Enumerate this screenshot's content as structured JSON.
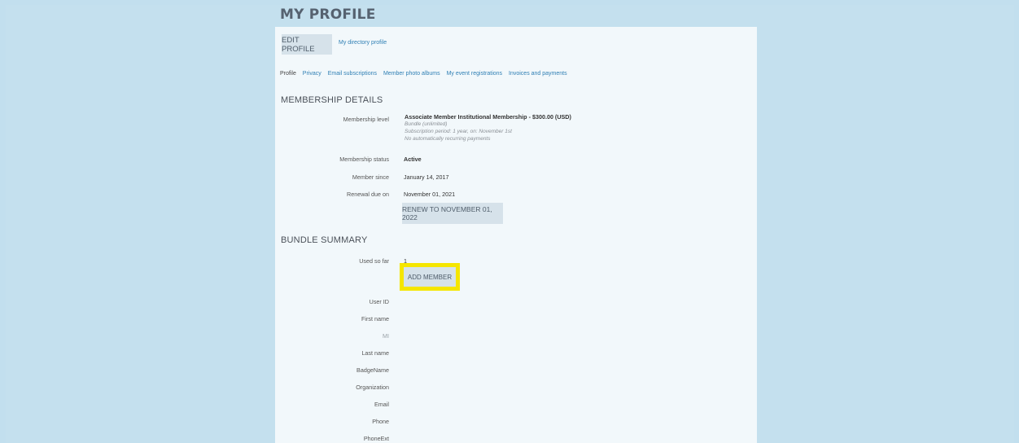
{
  "page": {
    "title": "MY PROFILE",
    "buttons": {
      "edit_profile": "EDIT PROFILE",
      "directory_profile": "My directory profile"
    },
    "tabs": [
      "Profile",
      "Privacy",
      "Email subscriptions",
      "Member photo albums",
      "My event registrations",
      "Invoices and payments"
    ]
  },
  "membership": {
    "section_title": "MEMBERSHIP DETAILS",
    "level_label": "Membership level",
    "level_value": "Associate Member Institutional Membership - $300.00 (USD)",
    "level_detail_1": "Bundle (unlimited)",
    "level_detail_2": "Subscription period: 1 year, on: November 1st",
    "level_detail_3": "No automatically recurring payments",
    "status_label": "Membership status",
    "status_value": "Active",
    "since_label": "Member since",
    "since_value": "January 14, 2017",
    "renewal_label": "Renewal due on",
    "renewal_value": "November 01, 2021",
    "renew_button": "RENEW TO NOVEMBER 01, 2022"
  },
  "bundle": {
    "section_title": "BUNDLE SUMMARY",
    "used_label": "Used so far",
    "used_value": "1",
    "add_member_button": "ADD MEMBER",
    "fields": [
      {
        "label": "User ID",
        "value": ""
      },
      {
        "label": "First name",
        "value": ""
      },
      {
        "label": "MI",
        "value": ""
      },
      {
        "label": "Last name",
        "value": ""
      },
      {
        "label": "BadgeName",
        "value": ""
      },
      {
        "label": "Organization",
        "value": ""
      },
      {
        "label": "Email",
        "value": ""
      },
      {
        "label": "Phone",
        "value": ""
      },
      {
        "label": "PhoneExt",
        "value": ""
      }
    ]
  },
  "colors": {
    "page_background": "#c2dfee",
    "panel_background": "#f2f8fb",
    "button_background": "#d6e2ea",
    "link_color": "#2f7fb4",
    "highlight": "#f5e600"
  }
}
